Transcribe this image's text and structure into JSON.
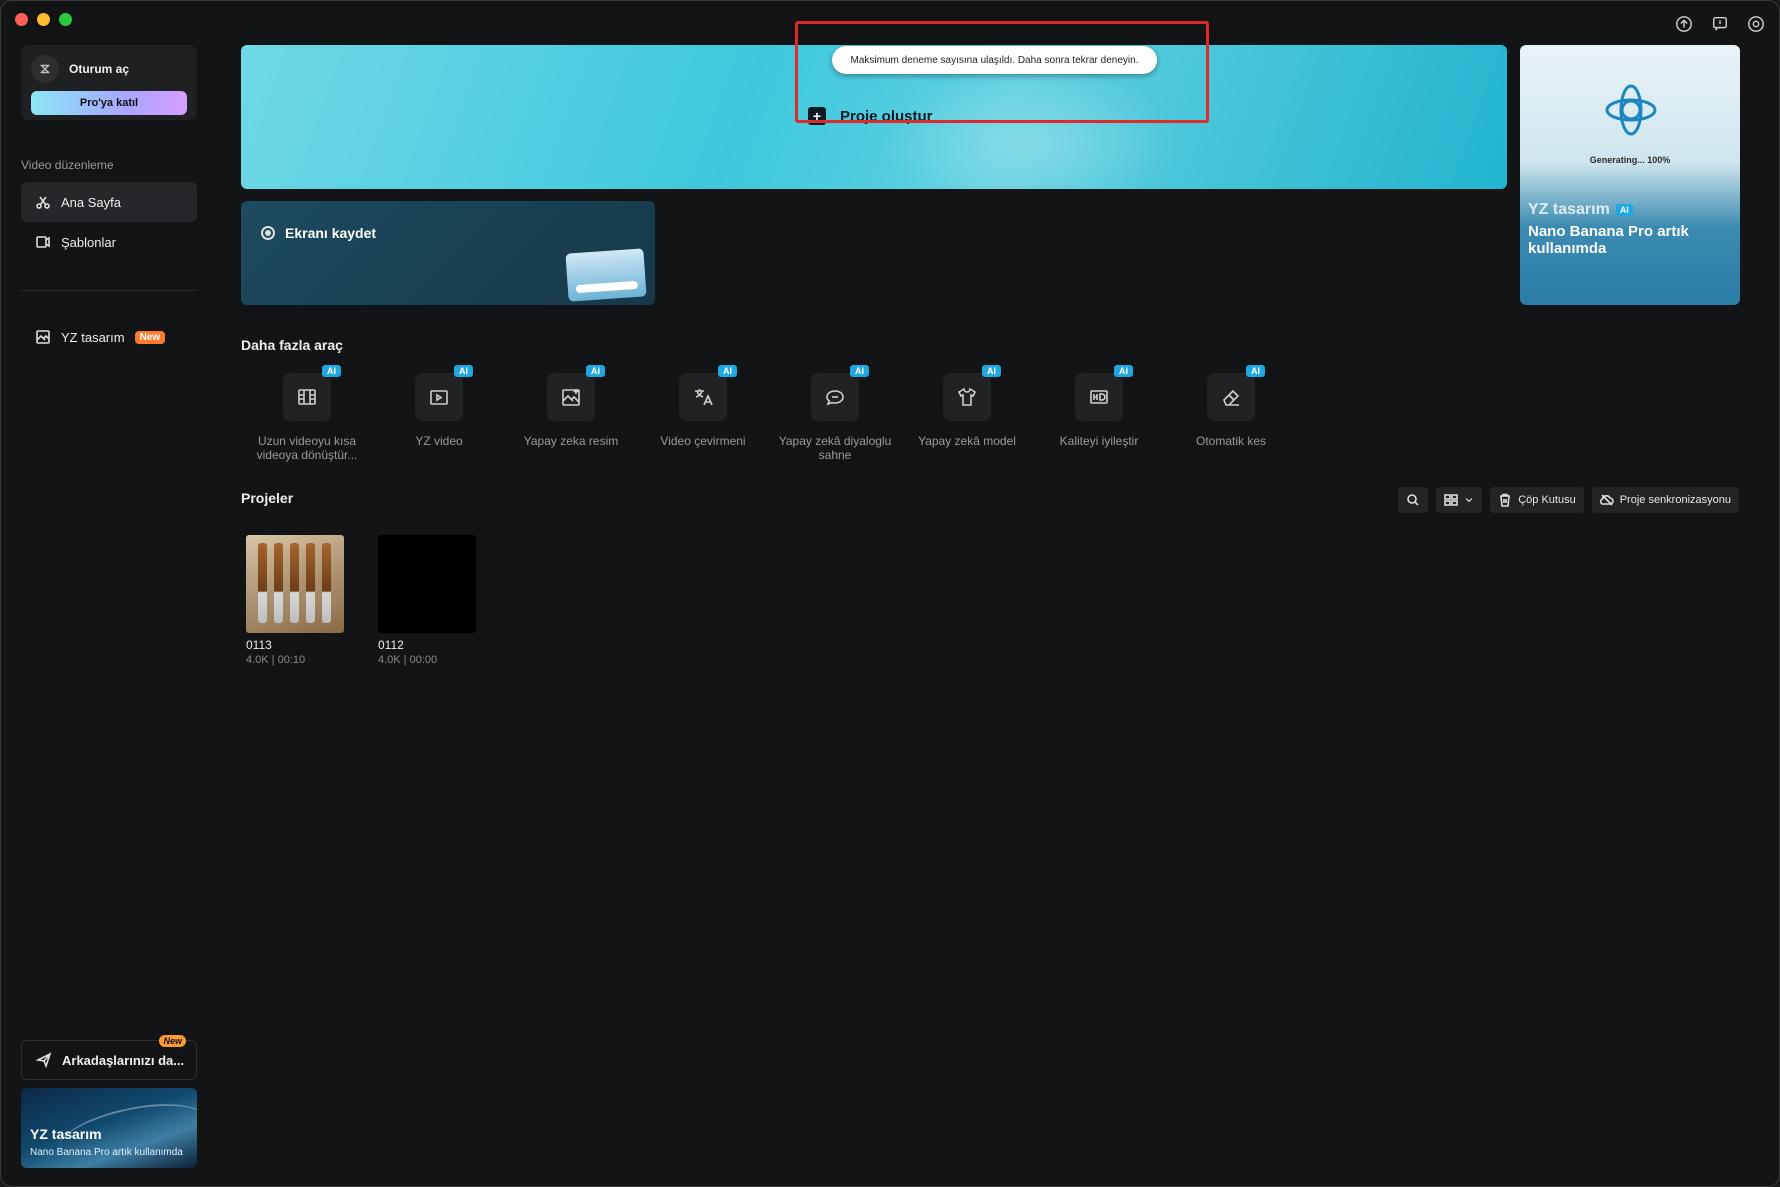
{
  "sidebar": {
    "login_label": "Oturum aç",
    "pro_button": "Pro'ya katıl",
    "section_label": "Video düzenleme",
    "nav": [
      {
        "label": "Ana Sayfa",
        "icon": "scissors-icon"
      },
      {
        "label": "Şablonlar",
        "icon": "template-icon"
      }
    ],
    "ai_design": {
      "label": "YZ tasarım",
      "badge": "New"
    },
    "invite": {
      "label": "Arkadaşlarınızı da...",
      "tag": "New"
    },
    "promo": {
      "title": "YZ tasarım",
      "subtitle": "Nano Banana Pro artık kullanımda"
    }
  },
  "hero": {
    "create_label": "Proje oluştur",
    "toast": "Maksimum deneme sayısına ulaşıldı. Daha sonra tekrar deneyin."
  },
  "record": {
    "label": "Ekranı kaydet"
  },
  "side_banner": {
    "generating": "Generating... 100%",
    "tag": "YZ tasarım",
    "ai_badge": "AI",
    "title": "Nano Banana Pro artık kullanımda"
  },
  "more_tools": {
    "heading": "Daha fazla araç",
    "badge": "AI",
    "items": [
      {
        "label": "Uzun videoyu kısa videoya dönüştür...",
        "icon": "film-cut-icon"
      },
      {
        "label": "YZ video",
        "icon": "ai-video-icon"
      },
      {
        "label": "Yapay zeka resim",
        "icon": "ai-image-icon"
      },
      {
        "label": "Video çevirmeni",
        "icon": "translate-icon"
      },
      {
        "label": "Yapay zekâ diyaloglu sahne",
        "icon": "dialog-scene-icon"
      },
      {
        "label": "Yapay zekâ model",
        "icon": "shirt-icon"
      },
      {
        "label": "Kaliteyi iyileştir",
        "icon": "hd-icon"
      },
      {
        "label": "Otomatik kes",
        "icon": "eraser-icon"
      }
    ]
  },
  "projects": {
    "heading": "Projeler",
    "trash_label": "Çöp Kutusu",
    "sync_label": "Proje senkronizasyonu",
    "items": [
      {
        "name": "0113",
        "meta": "4.0K | 00:10"
      },
      {
        "name": "0112",
        "meta": "4.0K | 00:00"
      }
    ]
  },
  "colors": {
    "accent": "#1ea7e1",
    "hero": "#3ec8de",
    "highlight": "#e02a2a",
    "new_badge": "#ff7a2f"
  }
}
